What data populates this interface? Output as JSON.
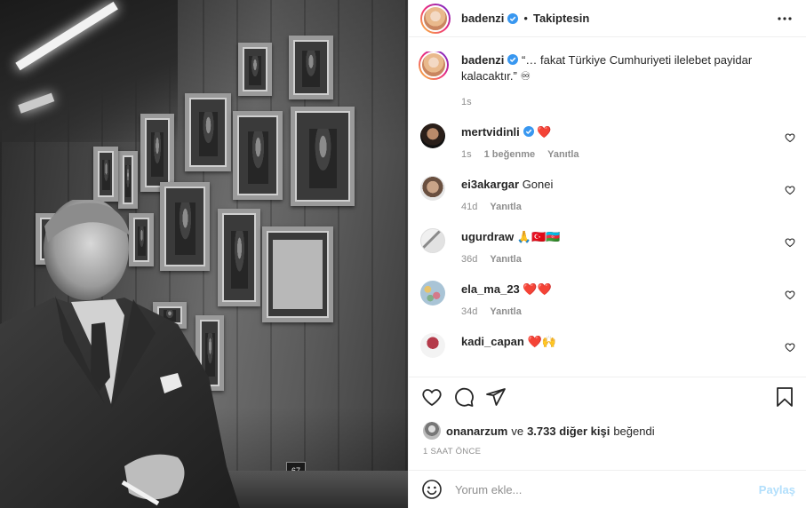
{
  "post": {
    "author": "badenzi",
    "follow_status": "Takiptesin",
    "separator": "•",
    "caption": "“… fakat Türkiye Cumhuriyeti ilelebet payidar kalacaktır.” ♾",
    "caption_age": "1s",
    "photo_frame_number": "67"
  },
  "icons": {
    "verified": "verified-badge-icon",
    "more": "more-options-icon",
    "like": "heart-icon",
    "comment": "comment-bubble-icon",
    "share": "paper-plane-icon",
    "save": "bookmark-icon",
    "emoji": "emoji-smiley-icon"
  },
  "colors": {
    "verified": "#3897f0",
    "link_disabled": "#b2dffc",
    "muted": "#8e8e8e",
    "heart_red": "#ed4956"
  },
  "comments": [
    {
      "user": "mertvidinli",
      "verified": true,
      "text": "❤️",
      "age": "1s",
      "likes": "1 beğenme",
      "reply": "Yanıtla"
    },
    {
      "user": "ei3akargar",
      "verified": false,
      "text": "Gonei",
      "age": "41d",
      "reply": "Yanıtla"
    },
    {
      "user": "ugurdraw",
      "verified": false,
      "text": "🙏🇹🇷🇦🇿",
      "age": "36d",
      "reply": "Yanıtla"
    },
    {
      "user": "ela_ma_23",
      "verified": false,
      "text": "❤️❤️",
      "age": "34d",
      "reply": "Yanıtla"
    },
    {
      "user": "kadi_capan",
      "verified": false,
      "text": "❤️🙌",
      "age": "",
      "reply": "Yanıtla"
    }
  ],
  "likes": {
    "first_user": "onanarzum",
    "connector": "ve",
    "others": "3.733 diğer kişi",
    "suffix": "beğendi"
  },
  "timestamp": "1 SAAT ÖNCE",
  "comment_input": {
    "placeholder": "Yorum ekle...",
    "post_label": "Paylaş"
  }
}
